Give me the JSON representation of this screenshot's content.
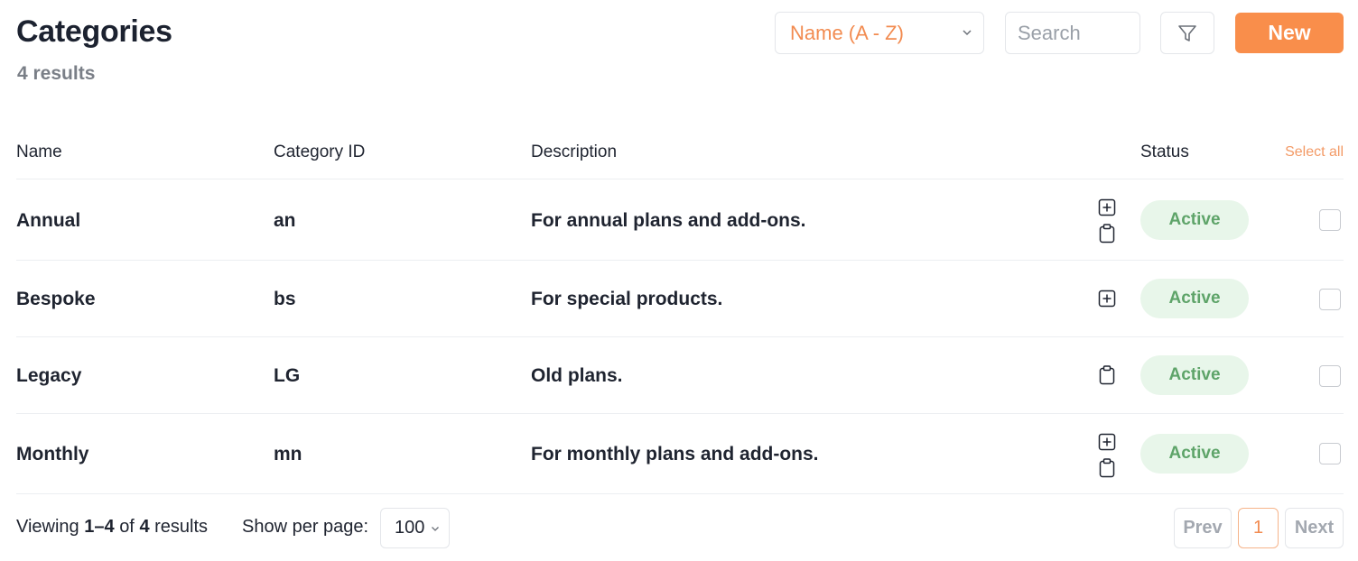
{
  "header": {
    "title": "Categories",
    "results": "4 results",
    "sort_value": "Name (A - Z)",
    "search_placeholder": "Search",
    "new_label": "New"
  },
  "table": {
    "columns": [
      "Name",
      "Category ID",
      "Description",
      "Status"
    ],
    "select_all": "Select all",
    "rows": [
      {
        "name": "Annual",
        "id": "an",
        "description": "For annual plans and add-ons.",
        "status": "Active",
        "icons": [
          "plus-square-icon",
          "clipboard-icon"
        ]
      },
      {
        "name": "Bespoke",
        "id": "bs",
        "description": "For special products.",
        "status": "Active",
        "icons": [
          "plus-square-icon"
        ]
      },
      {
        "name": "Legacy",
        "id": "LG",
        "description": "Old plans.",
        "status": "Active",
        "icons": [
          "clipboard-icon"
        ]
      },
      {
        "name": "Monthly",
        "id": "mn",
        "description": "For monthly plans and add-ons.",
        "status": "Active",
        "icons": [
          "plus-square-icon",
          "clipboard-icon"
        ]
      }
    ]
  },
  "footer": {
    "viewing_prefix": "Viewing",
    "viewing_range": "1–4",
    "viewing_of": "of",
    "viewing_total": "4",
    "viewing_suffix": "results",
    "per_page_label": "Show per page:",
    "per_page_value": "100",
    "prev_label": "Prev",
    "current_page": "1",
    "next_label": "Next"
  },
  "colors": {
    "accent": "#f98e4b",
    "status_bg": "#e8f6ea",
    "status_text": "#5ea469"
  }
}
